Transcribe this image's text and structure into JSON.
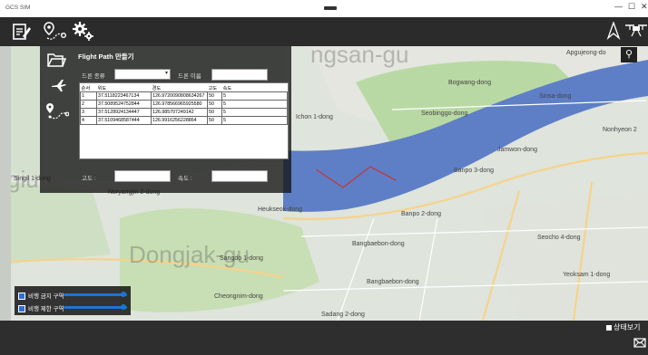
{
  "window": {
    "title": "GCS SIM",
    "minimize": "—",
    "maximize": "☐",
    "close": "✕"
  },
  "map": {
    "watermark": "ngsan-gu",
    "watermark2": "Dongjak-gu",
    "watermark3": "giu",
    "labels": {
      "apgujeong": "Apgujeong-do",
      "bogwang": "Bogwang-dong",
      "sinsa": "Sinsa-dong",
      "ichon": "Ichon 1-dong",
      "seobinggo": "Seobinggo-dong",
      "nonhyeon": "Nonhyeon 2",
      "jamwon": "Jamwon-dong",
      "banpo3": "Banpo 3-dong",
      "singil": "Singil 1-dong",
      "noryangjin": "Noryangjin 2-dong",
      "heukseok": "Heukseok-dong",
      "banpo2": "Banpo 2-dong",
      "bangbaebon": "Bangbaebon-dong",
      "seocho4": "Seocho 4-dong",
      "sangdo1": "Sangdo 1-dong",
      "yeoksam": "Yeoksam 1-dong",
      "bangbae": "Bangbaebon-dong",
      "cheongnim": "Cheongnim-dong",
      "sadang": "Sadang 2-dong"
    }
  },
  "flight_path": {
    "title": "Flight Path 만들기",
    "route_select_label": "드론 종류",
    "route_select_value": "",
    "drone_name_label": "드론 이름",
    "drone_name_value": "",
    "table": {
      "headers": [
        "순서",
        "위도",
        "경도",
        "고도",
        "속도"
      ],
      "rows": [
        [
          "1",
          "37.5118223467134",
          "126.9720090808634267",
          "50",
          "5"
        ],
        [
          "2",
          "37.5089524752844",
          "126.978566965925580",
          "50",
          "5"
        ],
        [
          "3",
          "37.5128924134447",
          "126.985707249142",
          "50",
          "5"
        ],
        [
          "4",
          "37.5109468587444",
          "126.9916256228864",
          "50",
          "5"
        ]
      ]
    },
    "altitude_label": "고도 :",
    "altitude_value": "",
    "speed_label": "속도 :",
    "speed_value": ""
  },
  "legend": {
    "item1": "비행 금지 구역",
    "item2": "비행 제한 구역",
    "slider1_level": 0.62,
    "slider2_level": 0.62
  },
  "status": {
    "status_label": "상태보기"
  },
  "colors": {
    "accent": "#1f73d8",
    "river": "#5e7fc6",
    "route": "#c0393b"
  },
  "icons": {
    "toolbar": [
      "edit-document-icon",
      "waypoint-route-icon",
      "settings-gears-icon"
    ],
    "right": [
      "drone-arrow-icon",
      "quadcopter-icon"
    ],
    "panel": [
      "folder-icon",
      "airplane-icon",
      "path-points-icon"
    ]
  }
}
